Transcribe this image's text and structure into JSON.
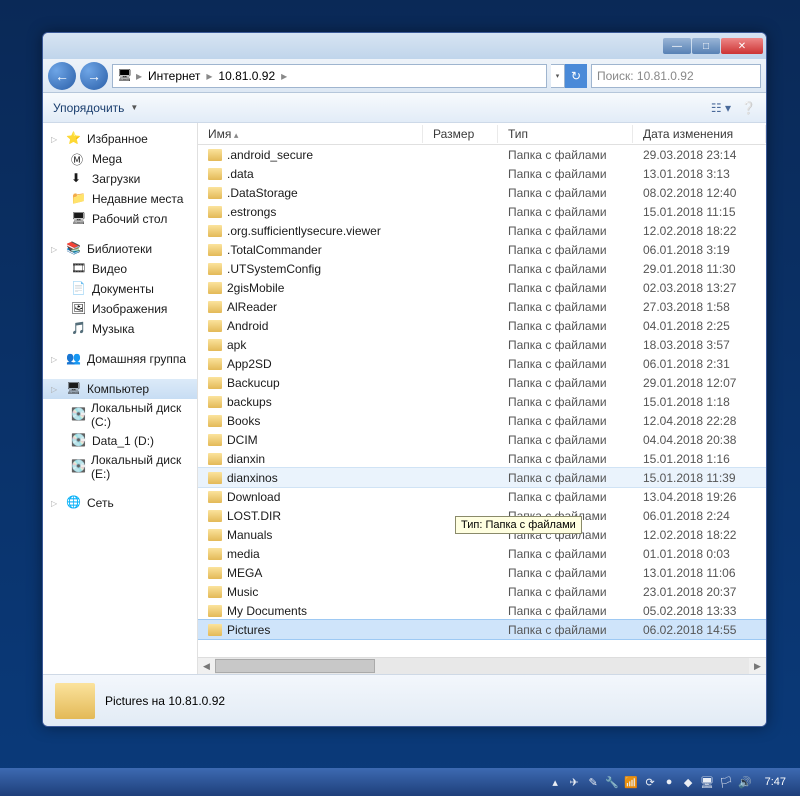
{
  "window": {
    "breadcrumb": {
      "root": "Интернет",
      "host": "10.81.0.92"
    },
    "search_placeholder": "Поиск: 10.81.0.92"
  },
  "toolbar": {
    "organize": "Упорядочить"
  },
  "sidebar": {
    "favorites": {
      "label": "Избранное",
      "items": [
        {
          "label": "Mega",
          "icon": "Ⓜ"
        },
        {
          "label": "Загрузки",
          "icon": "⬇"
        },
        {
          "label": "Недавние места",
          "icon": "📁"
        },
        {
          "label": "Рабочий стол",
          "icon": "🖥"
        }
      ]
    },
    "libraries": {
      "label": "Библиотеки",
      "items": [
        {
          "label": "Видео",
          "icon": "🎞"
        },
        {
          "label": "Документы",
          "icon": "📄"
        },
        {
          "label": "Изображения",
          "icon": "🖼"
        },
        {
          "label": "Музыка",
          "icon": "🎵"
        }
      ]
    },
    "homegroup": {
      "label": "Домашняя группа"
    },
    "computer": {
      "label": "Компьютер",
      "items": [
        {
          "label": "Локальный диск (C:)",
          "icon": "💽"
        },
        {
          "label": "Data_1 (D:)",
          "icon": "💽"
        },
        {
          "label": "Локальный диск (E:)",
          "icon": "💽"
        }
      ]
    },
    "network": {
      "label": "Сеть"
    }
  },
  "columns": {
    "name": "Имя",
    "size": "Размер",
    "type": "Тип",
    "date": "Дата изменения"
  },
  "type_label": "Папка с файлами",
  "rows": [
    {
      "name": ".android_secure",
      "date": "29.03.2018 23:14"
    },
    {
      "name": ".data",
      "date": "13.01.2018 3:13"
    },
    {
      "name": ".DataStorage",
      "date": "08.02.2018 12:40"
    },
    {
      "name": ".estrongs",
      "date": "15.01.2018 11:15"
    },
    {
      "name": ".org.sufficientlysecure.viewer",
      "date": "12.02.2018 18:22"
    },
    {
      "name": ".TotalCommander",
      "date": "06.01.2018 3:19"
    },
    {
      "name": ".UTSystemConfig",
      "date": "29.01.2018 11:30"
    },
    {
      "name": "2gisMobile",
      "date": "02.03.2018 13:27"
    },
    {
      "name": "AlReader",
      "date": "27.03.2018 1:58"
    },
    {
      "name": "Android",
      "date": "04.01.2018 2:25"
    },
    {
      "name": "apk",
      "date": "18.03.2018 3:57"
    },
    {
      "name": "App2SD",
      "date": "06.01.2018 2:31"
    },
    {
      "name": "Backucup",
      "date": "29.01.2018 12:07"
    },
    {
      "name": "backups",
      "date": "15.01.2018 1:18"
    },
    {
      "name": "Books",
      "date": "12.04.2018 22:28"
    },
    {
      "name": "DCIM",
      "date": "04.04.2018 20:38"
    },
    {
      "name": "dianxin",
      "date": "15.01.2018 1:16"
    },
    {
      "name": "dianxinos",
      "date": "15.01.2018 11:39",
      "hover": true
    },
    {
      "name": "Download",
      "date": "13.04.2018 19:26"
    },
    {
      "name": "LOST.DIR",
      "date": "06.01.2018 2:24"
    },
    {
      "name": "Manuals",
      "date": "12.02.2018 18:22"
    },
    {
      "name": "media",
      "date": "01.01.2018 0:03"
    },
    {
      "name": "MEGA",
      "date": "13.01.2018 11:06"
    },
    {
      "name": "Music",
      "date": "23.01.2018 20:37"
    },
    {
      "name": "My Documents",
      "date": "05.02.2018 13:33"
    },
    {
      "name": "Pictures",
      "date": "06.02.2018 14:55",
      "selected": true
    }
  ],
  "tooltip": {
    "label": "Тип:",
    "value": "Папка с файлами"
  },
  "details": {
    "title": "Pictures на 10.81.0.92"
  },
  "taskbar": {
    "clock": "7:47"
  }
}
